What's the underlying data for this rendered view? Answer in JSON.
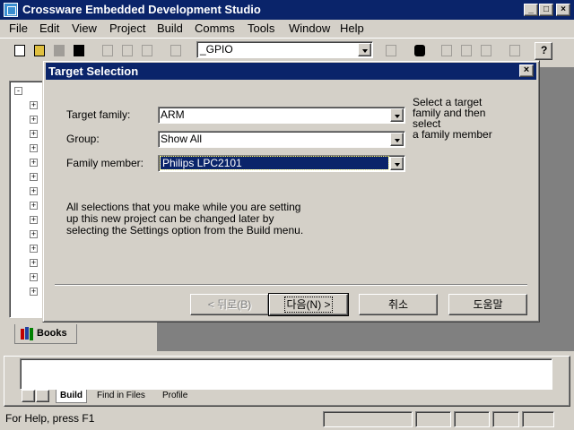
{
  "app": {
    "title": "Crossware Embedded Development Studio"
  },
  "menu": [
    "File",
    "Edit",
    "View",
    "Project",
    "Build",
    "Comms",
    "Tools",
    "Window",
    "Help"
  ],
  "toolbar": {
    "combo_value": "_GPIO"
  },
  "left_pane": {
    "tab_label": "Books"
  },
  "output_tabs": [
    "Build",
    "Find in Files",
    "Profile"
  ],
  "status": {
    "text": "For Help, press F1"
  },
  "dialog": {
    "title": "Target Selection",
    "fields": {
      "target_family": {
        "label": "Target family:",
        "value": "ARM"
      },
      "group": {
        "label": "Group:",
        "value": "Show All"
      },
      "family_member": {
        "label": "Family member:",
        "value": "Philips LPC2101"
      }
    },
    "hint": [
      "Select a target",
      "family and then",
      "select",
      "a family member"
    ],
    "note": [
      "All selections that you make while you are setting",
      "up this new project can be changed later by",
      "selecting the Settings option from the Build menu."
    ],
    "buttons": {
      "back": "< 뒤로(B)",
      "next": "다음(N) >",
      "cancel": "취소",
      "help": "도움말"
    }
  }
}
